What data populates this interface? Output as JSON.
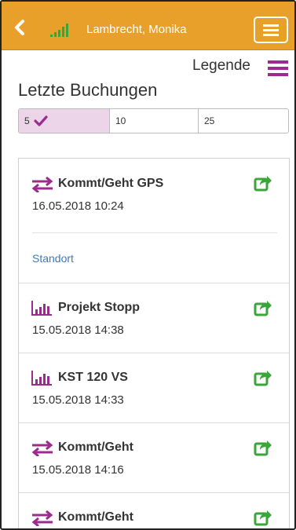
{
  "header": {
    "user_name": "Lambrecht, Monika",
    "back_icon": "chevron-left-icon",
    "signal_icon": "signal-bars-icon",
    "menu_icon": "hamburger-icon",
    "background": "#e8a02a"
  },
  "legend": {
    "label": "Legende",
    "icon": "list-icon",
    "color": "#9b2c8d"
  },
  "title": "Letzte Buchungen",
  "count_selector": {
    "options": [
      "5",
      "10",
      "25"
    ],
    "selected": "5",
    "selected_color": "#ecd4e9"
  },
  "bookings": [
    {
      "icon": "transfer-arrows-icon",
      "title": "Kommt/Geht GPS",
      "datetime": "16.05.2018 10:24",
      "link": "Standort"
    },
    {
      "icon": "bar-chart-icon",
      "title": "Projekt Stopp",
      "datetime": "15.05.2018 14:38"
    },
    {
      "icon": "bar-chart-icon",
      "title": "KST 120 VS",
      "datetime": "15.05.2018 14:33"
    },
    {
      "icon": "transfer-arrows-icon",
      "title": "Kommt/Geht",
      "datetime": "15.05.2018 14:16"
    },
    {
      "icon": "transfer-arrows-icon",
      "title": "Kommt/Geht",
      "datetime": ""
    }
  ],
  "colors": {
    "accent": "#9b2c8d",
    "share": "#3aa53a",
    "link": "#3e7ab8"
  }
}
